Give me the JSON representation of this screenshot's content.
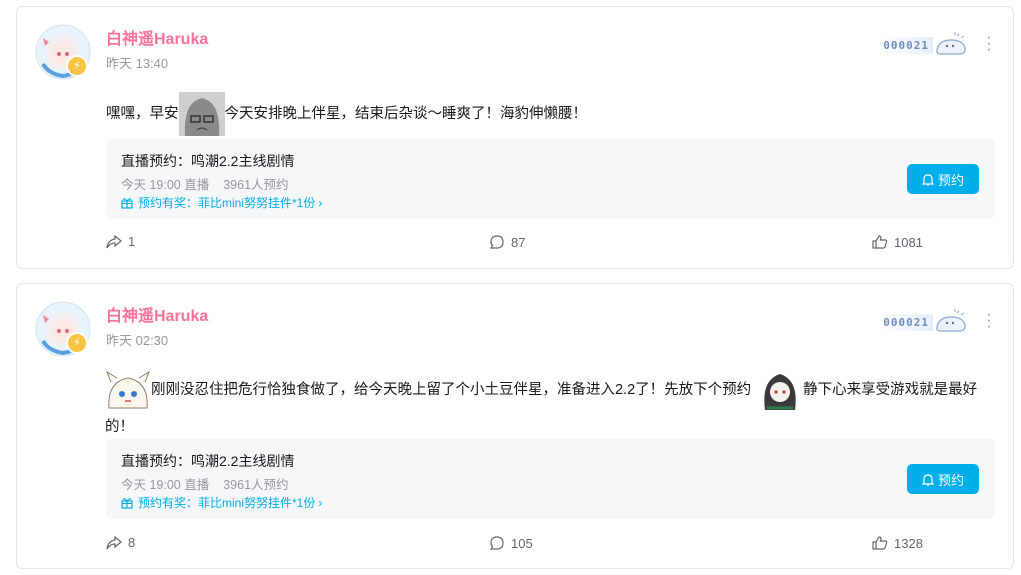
{
  "colors": {
    "username": "#fb7299",
    "accent": "#00aeec",
    "muted": "#9499a0",
    "verify": "#f6c543"
  },
  "posts": [
    {
      "author": "白神遥Haruka",
      "time": "昨天 13:40",
      "badge_number": "000021",
      "text_parts": [
        "嘿嘿，早安",
        "今天安排晚上伴星，结束后杂谈～睡爽了！海豹伸懒腰！"
      ],
      "reservation": {
        "title": "直播预约：鸣潮2.2主线剧情",
        "time": "今天 19:00 直播",
        "count": "3961人预约",
        "reward": "预约有奖：菲比mini努努挂件*1份",
        "button": "预约"
      },
      "forwards": "1",
      "comments": "87",
      "likes": "1081"
    },
    {
      "author": "白神遥Haruka",
      "time": "昨天 02:30",
      "badge_number": "000021",
      "text_parts": [
        "刚刚没忍住把危行恰独食做了，给今天晚上留了个小土豆伴星，准备进入2.2了！先放下个预约",
        "静下心来享受游戏就是最好的！"
      ],
      "reservation": {
        "title": "直播预约：鸣潮2.2主线剧情",
        "time": "今天 19:00 直播",
        "count": "3961人预约",
        "reward": "预约有奖：菲比mini努努挂件*1份",
        "button": "预约"
      },
      "forwards": "8",
      "comments": "105",
      "likes": "1328"
    }
  ]
}
